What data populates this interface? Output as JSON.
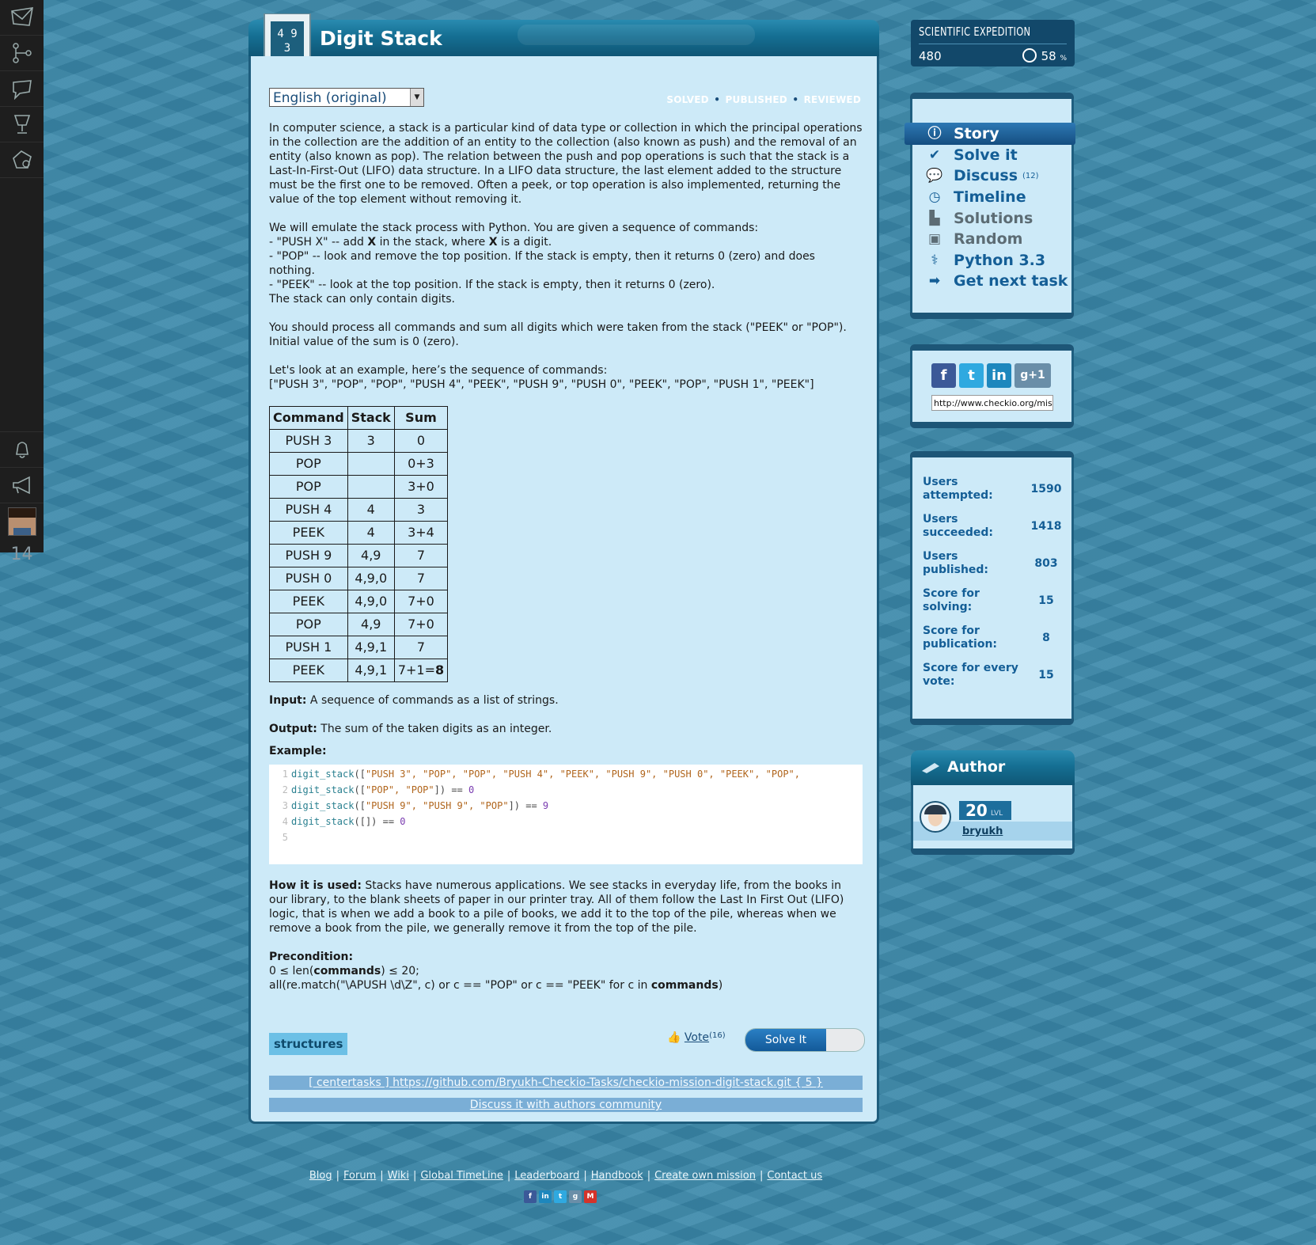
{
  "sidebar": {
    "icons": [
      "envelope-icon",
      "tree-icon",
      "chat-icon",
      "trophy-icon",
      "globe-icon"
    ],
    "notification_count": "14"
  },
  "mission": {
    "title": "Digit Stack",
    "language": "English (original)",
    "status": {
      "solved": "SOLVED",
      "published": "PUBLISHED",
      "reviewed": "REVIEWED",
      "separator": "•"
    }
  },
  "description": {
    "para1": "In computer science, a stack is a particular kind of data type or collection in which the principal operations in the collection are the addition of an entity to the collection (also known as push) and the removal of an entity (also known as pop). The relation between the push and pop operations is such that the stack is a Last-In-First-Out (LIFO) data structure. In a LIFO data structure, the last element added to the structure must be the first one to be removed. Often a peek, or top operation is also implemented, returning the value of the top element without removing it.",
    "para2_intro": "We will emulate the stack process with Python. You are given a sequence of commands:",
    "push_a": "- \"PUSH X\" -- add ",
    "push_x1": "X",
    "push_b": " in the stack, where ",
    "push_x2": "X",
    "push_c": " is a digit.",
    "pop_line": "- \"POP\" -- look and remove the top position. If the stack is empty, then it returns 0 (zero) and does nothing.",
    "peek_line": "- \"PEEK\" -- look at the top position. If the stack is empty, then it returns 0 (zero).",
    "digits_line": "The stack can only contain digits.",
    "para3": "You should process all commands and sum all digits which were taken from the stack (\"PEEK\" or \"POP\"). Initial value of the sum is 0 (zero).",
    "para4_intro": "Let's look at an example, here’s the sequence of commands:",
    "para4_seq": "[\"PUSH 3\", \"POP\", \"POP\", \"PUSH 4\", \"PEEK\", \"PUSH 9\", \"PUSH 0\", \"PEEK\", \"POP\", \"PUSH 1\", \"PEEK\"]"
  },
  "table": {
    "headers": [
      "Command",
      "Stack",
      "Sum"
    ],
    "rows": [
      [
        "PUSH 3",
        "3",
        "0"
      ],
      [
        "POP",
        "",
        "0+3"
      ],
      [
        "POP",
        "",
        "3+0"
      ],
      [
        "PUSH 4",
        "4",
        "3"
      ],
      [
        "PEEK",
        "4",
        "3+4"
      ],
      [
        "PUSH 9",
        "4,9",
        "7"
      ],
      [
        "PUSH 0",
        "4,9,0",
        "7"
      ],
      [
        "PEEK",
        "4,9,0",
        "7+0"
      ],
      [
        "POP",
        "4,9",
        "7+0"
      ],
      [
        "PUSH 1",
        "4,9,1",
        "7"
      ],
      [
        "PEEK",
        "4,9,1",
        "7+1="
      ]
    ],
    "final_bold": "8"
  },
  "io": {
    "input_label": "Input:",
    "input_text": " A sequence of commands as a list of strings.",
    "output_label": "Output:",
    "output_text": " The sum of the taken digits as an integer.",
    "example_label": "Example:"
  },
  "code": {
    "lines": [
      {
        "n": "1",
        "fn": "digit_stack",
        "open": "([",
        "args": "\"PUSH 3\", \"POP\", \"POP\", \"PUSH 4\", \"PEEK\", \"PUSH 9\", \"PUSH 0\", \"PEEK\", \"POP\",",
        "close": "",
        "op": "",
        "res": ""
      },
      {
        "n": "2",
        "fn": "digit_stack",
        "open": "([",
        "args": "\"POP\", \"POP\"",
        "close": "])",
        "op": " == ",
        "res": "0"
      },
      {
        "n": "3",
        "fn": "digit_stack",
        "open": "([",
        "args": "\"PUSH 9\", \"PUSH 9\", \"POP\"",
        "close": "])",
        "op": " == ",
        "res": "9"
      },
      {
        "n": "4",
        "fn": "digit_stack",
        "open": "([",
        "args": "",
        "close": "])",
        "op": " == ",
        "res": "0"
      },
      {
        "n": "5",
        "fn": "",
        "open": "",
        "args": "",
        "close": "",
        "op": "",
        "res": ""
      }
    ]
  },
  "usage": {
    "label": "How it is used:",
    "text": " Stacks have numerous applications. We see stacks in everyday life, from the books in our library, to the blank sheets of paper in our printer tray. All of them follow the Last In First Out (LIFO) logic, that is when we add a book to a pile of books, we add it to the top of the pile, whereas when we remove a book from the pile, we generally remove it from the top of the pile."
  },
  "precondition": {
    "label": "Precondition:",
    "line1_a": "0 ≤ len(",
    "line1_b": "commands",
    "line1_c": ") ≤ 20;",
    "line2_a": "all(re.match(\"\\APUSH \\d\\Z\", c) or c == \"POP\" or c == \"PEEK\" for c in ",
    "line2_b": "commands",
    "line2_c": ")"
  },
  "actions": {
    "tag": "structures",
    "vote_label": "Vote",
    "vote_count": "(16)",
    "solve_label": "Solve It"
  },
  "links": {
    "repo": "[ centertasks ] https://github.com/Bryukh-Checkio-Tasks/checkio-mission-digit-stack.git { 5 }",
    "discuss": "Discuss it with authors community"
  },
  "expedition": {
    "name": "SCIENTIFIC EXPEDITION",
    "points": "480",
    "percent": "58",
    "percent_unit": "%"
  },
  "menu": {
    "items": [
      {
        "label": "Story",
        "icon": "info-icon"
      },
      {
        "label": "Solve it",
        "icon": "check-icon"
      },
      {
        "label": "Discuss",
        "icon": "discuss-icon",
        "extra": "(12)"
      },
      {
        "label": "Timeline",
        "icon": "clock-icon"
      },
      {
        "label": "Solutions",
        "icon": "solutions-icon"
      },
      {
        "label": "Random",
        "icon": "box-icon"
      },
      {
        "label": "Python 3.3",
        "icon": "python-icon"
      },
      {
        "label": "Get next task",
        "icon": "arrow-icon"
      }
    ]
  },
  "share": {
    "url": "http://www.checkio.org/mission/digit-stack/"
  },
  "stats": [
    {
      "label": "Users attempted:",
      "value": "1590"
    },
    {
      "label": "Users succeeded:",
      "value": "1418"
    },
    {
      "label": "Users published:",
      "value": "803"
    },
    {
      "label": "Score for solving:",
      "value": "15"
    },
    {
      "label": "Score for publication:",
      "value": "8"
    },
    {
      "label": "Score for every vote:",
      "value": "15"
    }
  ],
  "author": {
    "heading": "Author",
    "level": "20",
    "level_unit": "LVL",
    "name": "bryukh"
  },
  "footer": {
    "links": [
      "Blog",
      "Forum",
      "Wiki",
      "Global TimeLine",
      "Leaderboard",
      "Handbook",
      "Create own mission",
      "Contact us"
    ],
    "separator": "|"
  },
  "colors": {
    "accent": "#145e96",
    "panel": "#cdeaf8",
    "border": "#1e5d7d",
    "background": "#3a88aa"
  }
}
